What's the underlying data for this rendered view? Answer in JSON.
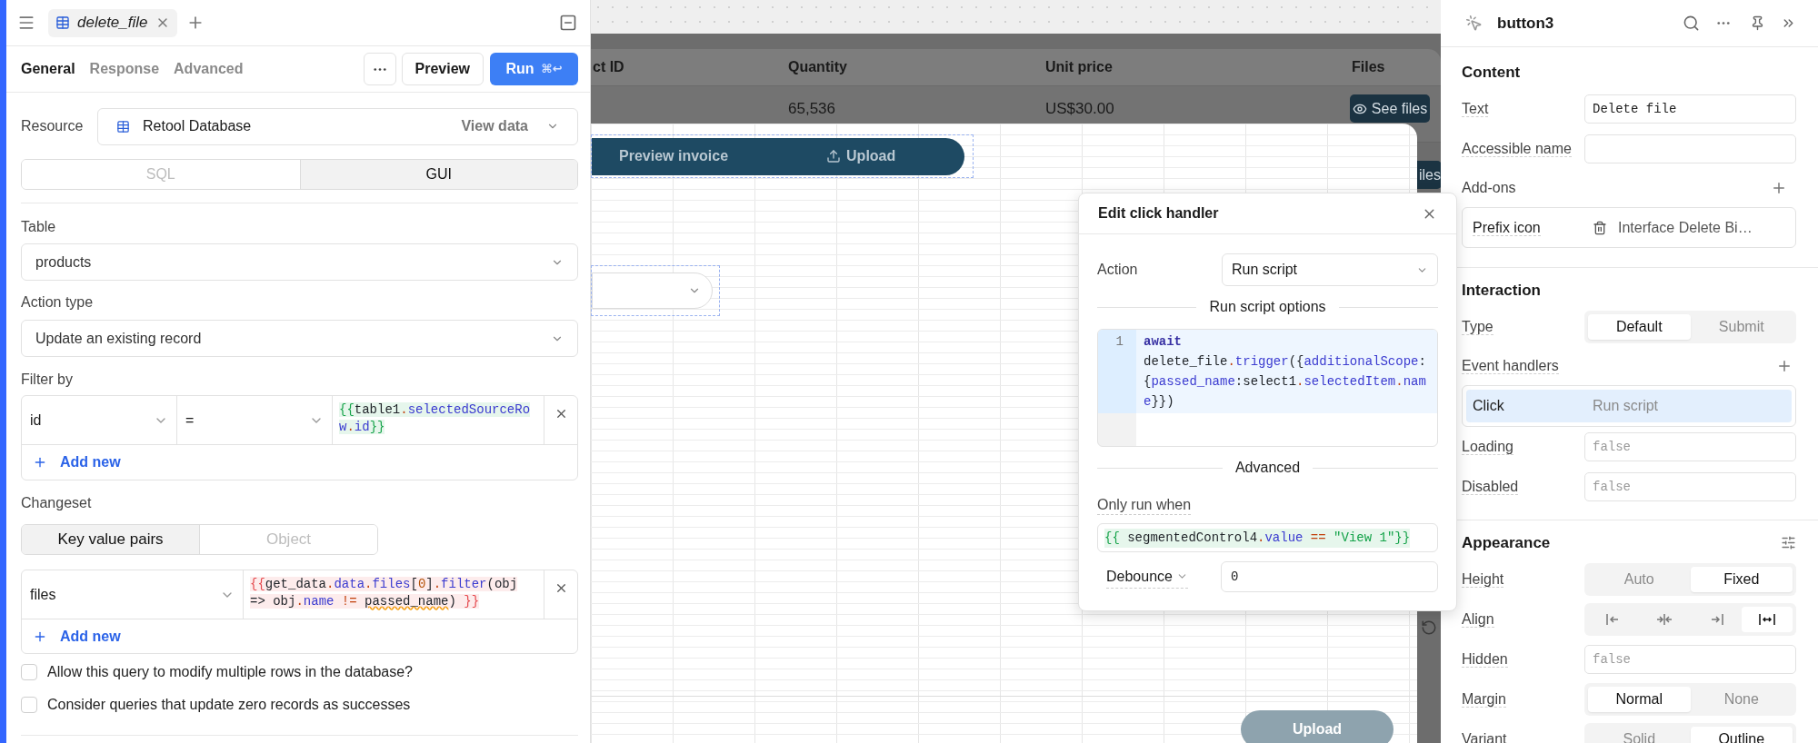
{
  "query_editor": {
    "tab": {
      "name": "delete_file"
    },
    "subtabs": [
      {
        "label": "General",
        "selected": true
      },
      {
        "label": "Response",
        "selected": false
      },
      {
        "label": "Advanced",
        "selected": false
      }
    ],
    "preview_button": "Preview",
    "run_button": {
      "label": "Run",
      "shortcut": "⌘↩"
    },
    "resource": {
      "label": "Resource",
      "value": "Retool Database",
      "action": "View data"
    },
    "modes": [
      {
        "label": "SQL",
        "selected": false
      },
      {
        "label": "GUI",
        "selected": true
      }
    ],
    "table": {
      "label": "Table",
      "value": "products"
    },
    "action_type": {
      "label": "Action type",
      "value": "Update an existing record"
    },
    "filter": {
      "label": "Filter by",
      "rows": [
        {
          "column": "id",
          "operator": "=",
          "value": {
            "error": false,
            "tokens": [
              {
                "text": "{{",
                "kind": "brace"
              },
              {
                "text": "table1",
                "kind": "plain"
              },
              {
                "text": ".",
                "kind": "op"
              },
              {
                "text": "selectedSourceRow",
                "kind": "prop"
              },
              {
                "text": ".",
                "kind": "op"
              },
              {
                "text": "id",
                "kind": "prop"
              },
              {
                "text": "}}",
                "kind": "brace"
              }
            ]
          }
        }
      ],
      "add": "Add new"
    },
    "changeset": {
      "label": "Changeset",
      "modes": [
        {
          "label": "Key value pairs",
          "selected": true
        },
        {
          "label": "Object",
          "selected": false
        }
      ],
      "rows": [
        {
          "key": "files",
          "value": {
            "error": true,
            "tokens": [
              {
                "text": "{{",
                "kind": "brace"
              },
              {
                "text": "get_data",
                "kind": "plain"
              },
              {
                "text": ".",
                "kind": "op"
              },
              {
                "text": "data",
                "kind": "prop"
              },
              {
                "text": ".",
                "kind": "op"
              },
              {
                "text": "files",
                "kind": "prop"
              },
              {
                "text": "[",
                "kind": "plain"
              },
              {
                "text": "0",
                "kind": "num"
              },
              {
                "text": "]",
                "kind": "plain"
              },
              {
                "text": ".",
                "kind": "op"
              },
              {
                "text": "filter",
                "kind": "prop"
              },
              {
                "text": "(obj => obj",
                "kind": "plain"
              },
              {
                "text": ".",
                "kind": "op"
              },
              {
                "text": "name",
                "kind": "prop"
              },
              {
                "text": " != ",
                "kind": "op"
              },
              {
                "text": "passed_name",
                "kind": "unknown"
              },
              {
                "text": ") ",
                "kind": "plain"
              },
              {
                "text": "}}",
                "kind": "brace"
              }
            ]
          }
        }
      ],
      "add": "Add new"
    },
    "options": [
      {
        "label": "Allow this query to modify multiple rows in the database?",
        "checked": false
      },
      {
        "label": "Consider queries that update zero records as successes",
        "checked": false
      }
    ]
  },
  "canvas": {
    "table": {
      "columns": [
        "ct ID",
        "Quantity",
        "Unit price",
        "Files"
      ],
      "rows": [
        {
          "quantity": "65,536",
          "unit_price": "US$30.00",
          "action": "See files"
        }
      ],
      "next_row_action": "iles"
    },
    "toolbar": [
      {
        "label": "Preview invoice",
        "kind": "text"
      },
      {
        "label": "Upload",
        "kind": "upload"
      }
    ],
    "upload_button": {
      "label": "Upload",
      "disabled": true
    }
  },
  "popup": {
    "title": "Edit click handler",
    "action": {
      "label": "Action",
      "value": "Run script"
    },
    "script_section": "Run script options",
    "script": {
      "line_number": "1",
      "tokens": [
        {
          "text": "await",
          "kind": "kw"
        },
        {
          "text": " delete_file",
          "kind": "plain"
        },
        {
          "text": ".",
          "kind": "op"
        },
        {
          "text": "trigger",
          "kind": "prop"
        },
        {
          "text": "({",
          "kind": "plain"
        },
        {
          "text": "additionalScope",
          "kind": "prop"
        },
        {
          "text": ":{",
          "kind": "plain"
        },
        {
          "text": "passed_name",
          "kind": "prop"
        },
        {
          "text": ":select1",
          "kind": "plain"
        },
        {
          "text": ".",
          "kind": "op"
        },
        {
          "text": "selectedItem",
          "kind": "prop"
        },
        {
          "text": ".",
          "kind": "op"
        },
        {
          "text": "name",
          "kind": "prop"
        },
        {
          "text": "}})",
          "kind": "plain"
        }
      ]
    },
    "advanced_section": "Advanced",
    "condition": {
      "label": "Only run when",
      "error": false,
      "tokens": [
        {
          "text": "{{",
          "kind": "brace"
        },
        {
          "text": " segmentedControl4",
          "kind": "plain"
        },
        {
          "text": ".",
          "kind": "op"
        },
        {
          "text": "value",
          "kind": "prop"
        },
        {
          "text": " == ",
          "kind": "op"
        },
        {
          "text": "\"View 1\"",
          "kind": "str"
        },
        {
          "text": "}}",
          "kind": "brace"
        }
      ]
    },
    "debounce": {
      "label": "Debounce",
      "value": "0"
    }
  },
  "inspector": {
    "title": "button3",
    "sections": [
      {
        "title": "Content",
        "rows": [
          {
            "kind": "field",
            "label": "Text",
            "value": "Delete file"
          },
          {
            "kind": "field",
            "label": "Accessible name"
          },
          {
            "kind": "addons",
            "label": "Add-ons",
            "items": [
              {
                "label": "Prefix icon",
                "value": "Interface Delete Bi…"
              }
            ]
          }
        ]
      },
      {
        "title": "Interaction",
        "rows": [
          {
            "kind": "segmented",
            "label": "Type",
            "options": [
              {
                "label": "Default",
                "selected": true
              },
              {
                "label": "Submit",
                "selected": false
              }
            ]
          },
          {
            "kind": "handlers",
            "label": "Event handlers",
            "items": [
              {
                "event": "Click",
                "action": "Run script",
                "selected": true
              }
            ]
          },
          {
            "kind": "field",
            "label": "Loading",
            "placeholder": "false"
          },
          {
            "kind": "field",
            "label": "Disabled",
            "placeholder": "false"
          }
        ]
      },
      {
        "title": "Appearance",
        "rows": [
          {
            "kind": "segmented",
            "label": "Height",
            "options": [
              {
                "label": "Auto",
                "selected": false
              },
              {
                "label": "Fixed",
                "selected": true
              }
            ]
          },
          {
            "kind": "icons",
            "label": "Align",
            "options": [
              {
                "kind": "left",
                "selected": false
              },
              {
                "kind": "center",
                "selected": false
              },
              {
                "kind": "right",
                "selected": false
              },
              {
                "kind": "stretch",
                "selected": true
              }
            ]
          },
          {
            "kind": "field",
            "label": "Hidden",
            "placeholder": "false"
          },
          {
            "kind": "segmented",
            "label": "Margin",
            "options": [
              {
                "label": "Normal",
                "selected": true
              },
              {
                "label": "None",
                "selected": false
              }
            ]
          },
          {
            "kind": "segmented",
            "label": "Variant",
            "options": [
              {
                "label": "Solid",
                "selected": false
              },
              {
                "label": "Outline",
                "selected": true
              }
            ]
          }
        ]
      }
    ]
  }
}
